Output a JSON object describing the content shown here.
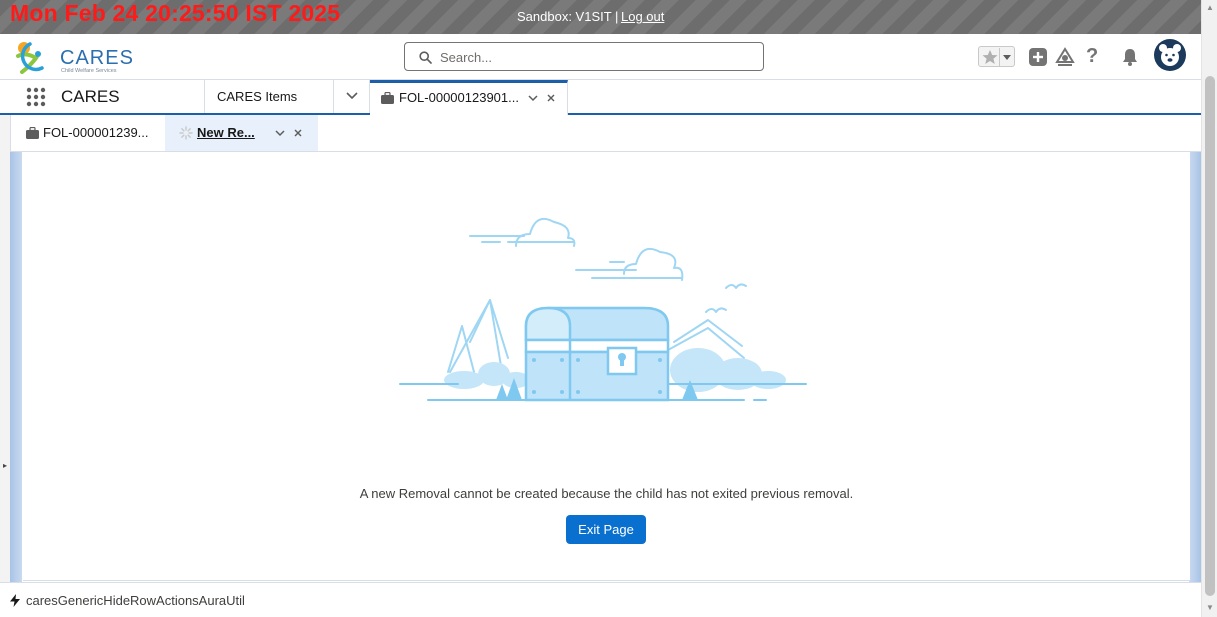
{
  "banner": {
    "clock": "Mon Feb 24 20:25:50 IST 2025",
    "sandbox_label": "Sandbox: V1SIT |",
    "logout_label": "Log out"
  },
  "header": {
    "logo_text": "CARES",
    "logo_subtitle": "Child Welfare Services",
    "search_placeholder": "Search..."
  },
  "nav": {
    "app_name": "CARES",
    "items": [
      {
        "label": "CARES Items"
      }
    ],
    "workspace_tab": {
      "label": "FOL-00000123901..."
    }
  },
  "subtabs": [
    {
      "label": "FOL-000001239...",
      "active": false
    },
    {
      "label": "New Re...",
      "active": true
    }
  ],
  "main": {
    "message": "A new Removal cannot be created because the child has not exited previous removal.",
    "exit_button_label": "Exit Page"
  },
  "utility_bar": {
    "item_label": "caresGenericHideRowActionsAuraUtil"
  },
  "colors": {
    "banner_clock": "#ff1a1a",
    "brand_blue": "#0a70d0",
    "nav_underline": "#1b5fa8",
    "illustration_blue": "#7fc8f0"
  }
}
